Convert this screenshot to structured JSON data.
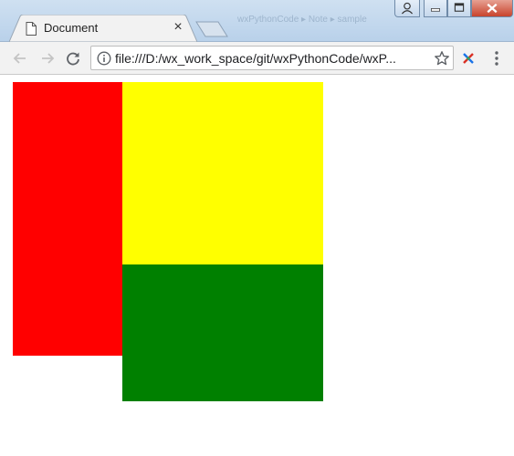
{
  "browser": {
    "tab": {
      "title": "Document",
      "close_glyph": "×",
      "icon": "page-icon"
    },
    "new_tab_icon": "new-tab-icon",
    "background_text": "wxPythonCode ▸ Note ▸ sample",
    "window_controls": [
      "user-icon",
      "minimize-icon",
      "maximize-icon",
      "close-icon"
    ],
    "toolbar": {
      "back_icon": "back-arrow-icon",
      "forward_icon": "forward-arrow-icon",
      "reload_icon": "reload-icon",
      "info_icon": "info-icon",
      "url": "file:///D:/wx_work_space/git/wxPythonCode/wxP...",
      "bookmark_icon": "star-icon",
      "extension_icon": "extension-icon",
      "menu_icon": "menu-icon"
    }
  },
  "page": {
    "boxes": [
      {
        "name": "red",
        "color": "#ff0000"
      },
      {
        "name": "yellow",
        "color": "#ffff00"
      },
      {
        "name": "green",
        "color": "#008000"
      }
    ]
  }
}
